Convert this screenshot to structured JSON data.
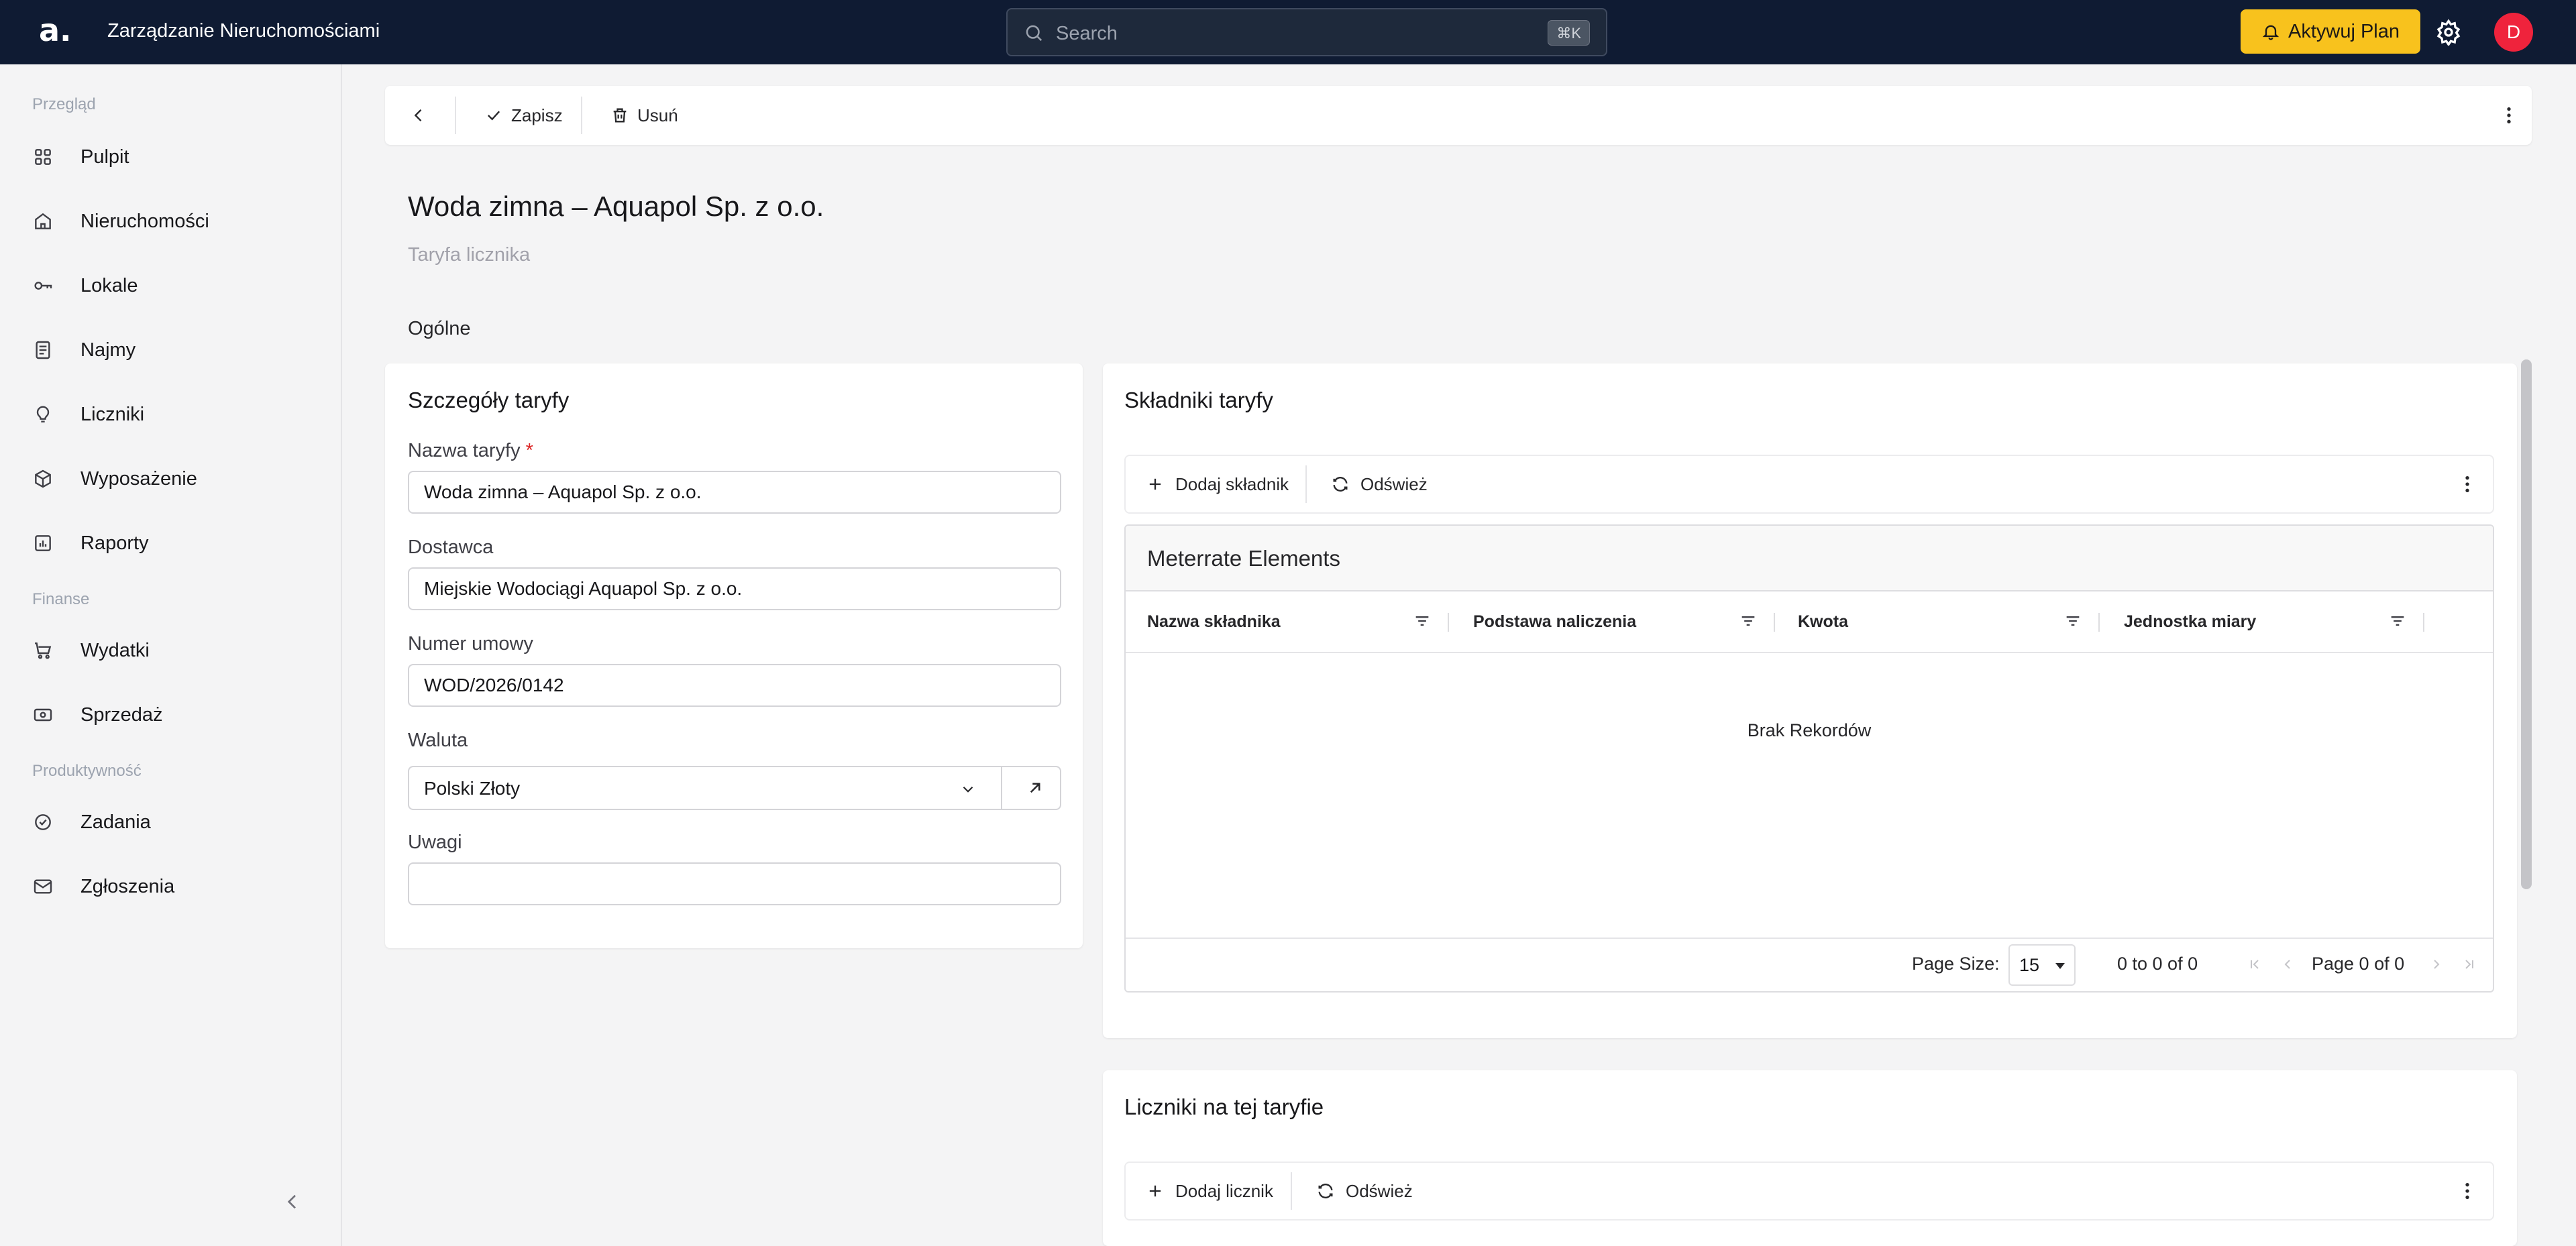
{
  "header": {
    "logo": "a.",
    "app_title": "Zarządzanie Nieruchomościami",
    "search_placeholder": "Search",
    "search_shortcut": "⌘K",
    "upgrade_label": "Aktywuj Plan",
    "avatar_initial": "D"
  },
  "sidebar": {
    "sections": [
      {
        "label": "Przegląd",
        "items": [
          {
            "label": "Pulpit",
            "icon": "grid-icon"
          },
          {
            "label": "Nieruchomości",
            "icon": "building-icon"
          },
          {
            "label": "Lokale",
            "icon": "key-icon"
          },
          {
            "label": "Najmy",
            "icon": "document-icon"
          },
          {
            "label": "Liczniki",
            "icon": "bulb-icon"
          },
          {
            "label": "Wyposażenie",
            "icon": "box-icon"
          },
          {
            "label": "Raporty",
            "icon": "report-icon"
          }
        ]
      },
      {
        "label": "Finanse",
        "items": [
          {
            "label": "Wydatki",
            "icon": "cart-icon"
          },
          {
            "label": "Sprzedaż",
            "icon": "cash-icon"
          }
        ]
      },
      {
        "label": "Produktywność",
        "items": [
          {
            "label": "Zadania",
            "icon": "check-circle-icon"
          },
          {
            "label": "Zgłoszenia",
            "icon": "mail-icon"
          }
        ]
      }
    ]
  },
  "toolbar": {
    "save_label": "Zapisz",
    "delete_label": "Usuń"
  },
  "page": {
    "title": "Woda zimna – Aquapol Sp. z o.o.",
    "subtitle": "Taryfa licznika",
    "section_tab": "Ogólne"
  },
  "details": {
    "title": "Szczegóły taryfy",
    "name_label": "Nazwa taryfy",
    "name_required": "*",
    "name_value": "Woda zimna – Aquapol Sp. z o.o.",
    "supplier_label": "Dostawca",
    "supplier_value": "Miejskie Wodociągi Aquapol Sp. z o.o.",
    "contract_label": "Numer umowy",
    "contract_value": "WOD/2026/0142",
    "currency_label": "Waluta",
    "currency_value": "Polski Złoty",
    "notes_label": "Uwagi",
    "notes_value": ""
  },
  "components": {
    "title": "Składniki taryfy",
    "add_label": "Dodaj składnik",
    "refresh_label": "Odśwież",
    "grid_title": "Meterrate Elements",
    "columns": [
      "Nazwa składnika",
      "Podstawa naliczenia",
      "Kwota",
      "Jednostka miary"
    ],
    "empty_text": "Brak Rekordów",
    "page_size_label": "Page Size:",
    "page_size_value": "15",
    "range_text": "0 to 0 of 0",
    "page_text": "Page 0 of 0"
  },
  "meters": {
    "title": "Liczniki na tej taryfie",
    "add_label": "Dodaj licznik",
    "refresh_label": "Odśwież"
  },
  "colors": {
    "header_bg": "#0f1b33",
    "accent": "#f8c21d",
    "avatar": "#ef233c"
  }
}
